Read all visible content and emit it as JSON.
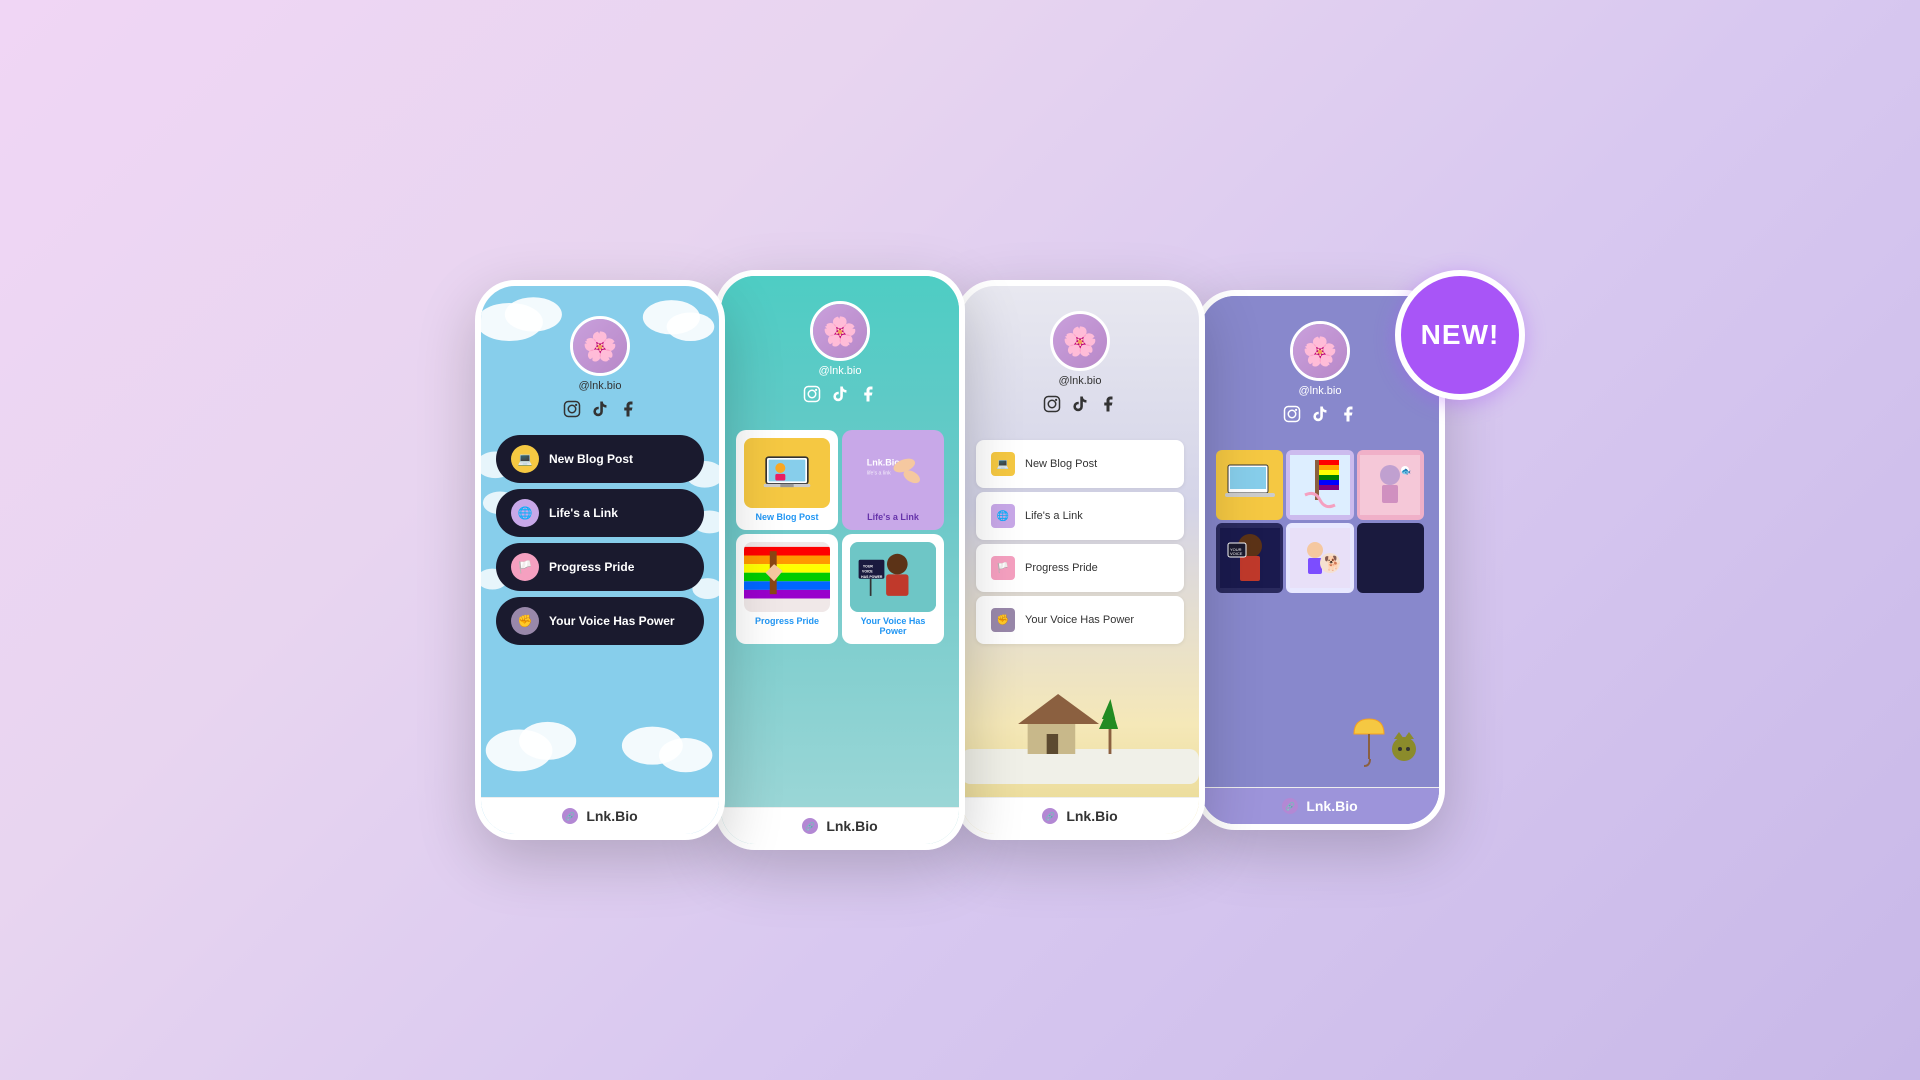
{
  "page": {
    "background": "linear-gradient(135deg, #f0d6f5, #e8d5f0, #d8c8f0, #c8b8e8)"
  },
  "new_badge": {
    "label": "NEW!"
  },
  "phone1": {
    "username": "@lnk.bio",
    "social": [
      "instagram",
      "tiktok",
      "facebook"
    ],
    "links": [
      {
        "id": "new-blog",
        "label": "New Blog Post"
      },
      {
        "id": "lifes-link",
        "label": "Life's a Link"
      },
      {
        "id": "progress-pride",
        "label": "Progress Pride"
      },
      {
        "id": "your-voice",
        "label": "Your Voice Has Power"
      }
    ],
    "footer": "Lnk.Bio"
  },
  "phone2": {
    "username": "@lnk.bio",
    "social": [
      "instagram",
      "tiktok",
      "facebook"
    ],
    "cards": [
      {
        "id": "new-blog",
        "label": "New Blog Post",
        "color": "#f5c842"
      },
      {
        "id": "lifes-link",
        "label": "Life's a Link",
        "color": "#c8a8e8"
      },
      {
        "id": "progress-pride",
        "label": "Progress Pride",
        "color": "#f5a0c0"
      },
      {
        "id": "your-voice",
        "label": "Your Voice Has Power",
        "color": "#6ec6c6"
      }
    ],
    "footer": "Lnk.Bio"
  },
  "phone3": {
    "username": "@lnk.bio",
    "social": [
      "instagram",
      "tiktok",
      "facebook"
    ],
    "links": [
      {
        "id": "new-blog",
        "label": "New Blog Post"
      },
      {
        "id": "lifes-link",
        "label": "Life's a Link"
      },
      {
        "id": "progress-pride",
        "label": "Progress Pride"
      },
      {
        "id": "your-voice",
        "label": "Your Voice Has Power"
      }
    ],
    "footer": "Lnk.Bio"
  },
  "phone4": {
    "username": "@lnk.bio",
    "social": [
      "instagram",
      "tiktok",
      "facebook"
    ],
    "footer": "Lnk.Bio"
  }
}
